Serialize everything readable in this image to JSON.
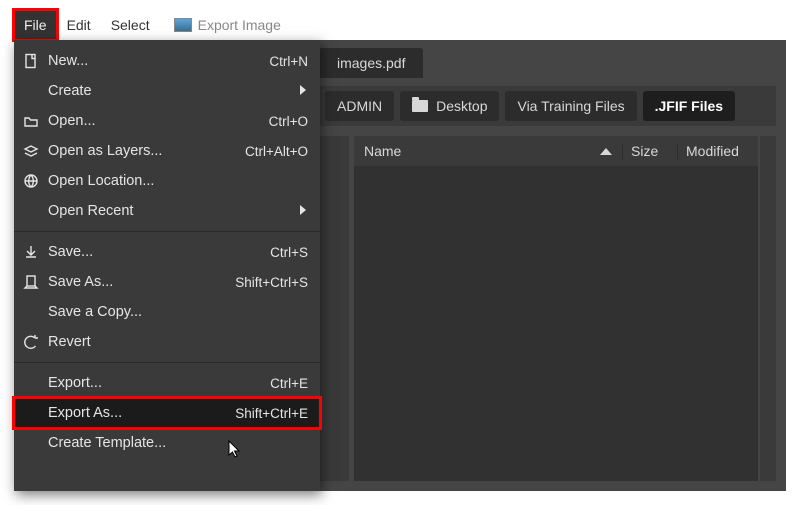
{
  "menubar": {
    "file": "File",
    "edit": "Edit",
    "select": "Select",
    "title": "Export Image"
  },
  "tab": {
    "label": "images.pdf"
  },
  "breadcrumbs": {
    "b0": "ADMIN",
    "b1": "Desktop",
    "b2": "Via Training Files",
    "b3": ".JFIF Files"
  },
  "columns": {
    "name": "Name",
    "size": "Size",
    "modified": "Modified"
  },
  "menu": {
    "new": "New...",
    "new_k": "Ctrl+N",
    "create": "Create",
    "open": "Open...",
    "open_k": "Ctrl+O",
    "open_layers": "Open as Layers...",
    "open_layers_k": "Ctrl+Alt+O",
    "open_loc": "Open Location...",
    "open_recent": "Open Recent",
    "save": "Save...",
    "save_k": "Ctrl+S",
    "save_as": "Save As...",
    "save_as_k": "Shift+Ctrl+S",
    "save_copy": "Save a Copy...",
    "revert": "Revert",
    "export": "Export...",
    "export_k": "Ctrl+E",
    "export_as": "Export As...",
    "export_as_k": "Shift+Ctrl+E",
    "create_tpl": "Create Template..."
  }
}
